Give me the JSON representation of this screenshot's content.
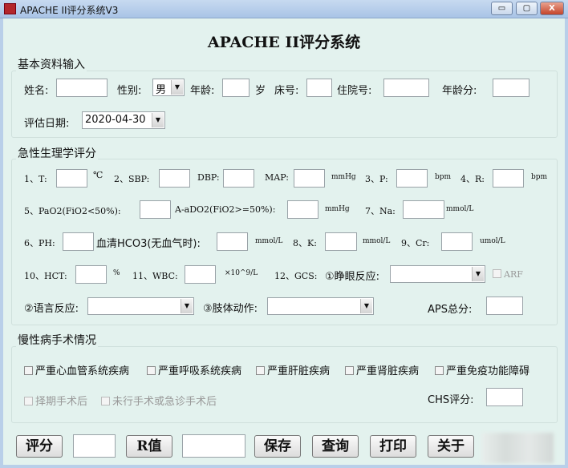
{
  "window": {
    "title": "APACHE II评分系统V3",
    "min": "▭",
    "max": "▢",
    "close": "X"
  },
  "header": {
    "title": "APACHE II评分系统"
  },
  "basic": {
    "legend": "基本资料输入",
    "name": "姓名:",
    "gender": "性别:",
    "gender_value": "男",
    "age": "年龄:",
    "age_unit": "岁",
    "bed": "床号:",
    "admission": "住院号:",
    "age_score": "年龄分:",
    "date_label": "评估日期:",
    "date_value": "2020-04-30"
  },
  "aps": {
    "legend": "急性生理学评分",
    "t": "1、T:",
    "t_unit": "℃",
    "sbp": "2、SBP:",
    "dbp": "DBP:",
    "map": "MAP:",
    "bp_unit": "mmHg",
    "p": "3、P:",
    "p_unit": "bpm",
    "r": "4、R:",
    "r_unit": "bpm",
    "pao2": "5、PaO2(FiO2<50%):",
    "aado2": "A-aDO2(FiO2>=50%):",
    "o2_unit": "mmHg",
    "na": "7、Na:",
    "na_unit": "mmol/L",
    "ph": "6、PH:",
    "hco3": "血清HCO3(无血气时):",
    "hco3_unit": "mmol/L",
    "k": "8、K:",
    "k_unit": "mmol/L",
    "cr": "9、Cr:",
    "cr_unit": "umol/L",
    "hct": "10、HCT:",
    "hct_unit": "%",
    "wbc": "11、WBC:",
    "wbc_unit": "×10^9/L",
    "gcs": "12、GCS:",
    "eye": "①睁眼反应:",
    "arf": "ARF",
    "verbal": "②语言反应:",
    "motor": "③肢体动作:",
    "total": "APS总分:"
  },
  "chronic": {
    "legend": "慢性病手术情况",
    "items": [
      "严重心血管系统疾病",
      "严重呼吸系统疾病",
      "严重肝脏疾病",
      "严重肾脏疾病",
      "严重免疫功能障碍"
    ],
    "surgery": [
      "择期手术后",
      "未行手术或急诊手术后"
    ],
    "chs": "CHS评分:"
  },
  "buttons": {
    "score": "评分",
    "r": "R值",
    "save": "保存",
    "query": "查询",
    "print": "打印",
    "about": "关于"
  }
}
